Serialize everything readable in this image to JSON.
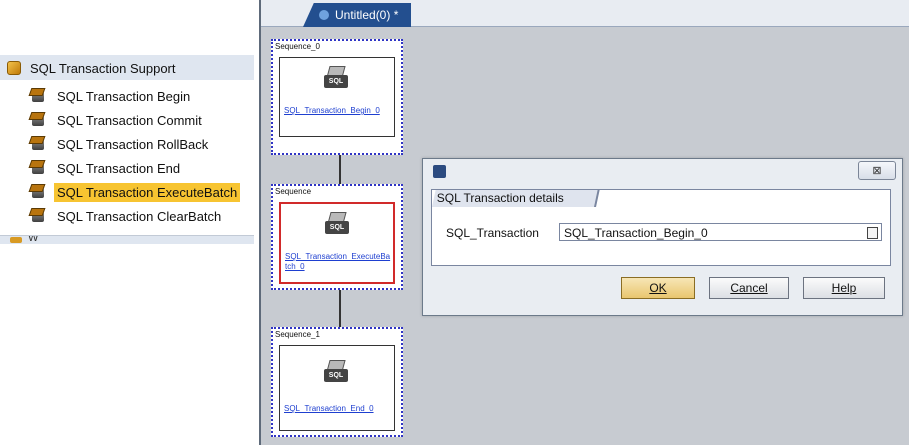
{
  "palette": {
    "header": "SQL Transaction Support",
    "items": [
      {
        "label": "SQL Transaction Begin",
        "selected": false
      },
      {
        "label": "SQL Transaction Commit",
        "selected": false
      },
      {
        "label": "SQL Transaction RollBack",
        "selected": false
      },
      {
        "label": "SQL Transaction End",
        "selected": false
      },
      {
        "label": "SQL Transaction ExecuteBatch",
        "selected": true
      },
      {
        "label": "SQL Transaction ClearBatch",
        "selected": false
      }
    ],
    "next_group_partial": "W"
  },
  "editor": {
    "tab_label": "Untitled(0) *",
    "sequences": [
      {
        "label": "Sequence_0",
        "icon_text": "SQL",
        "node_name": "SQL_Transaction_Begin_0"
      },
      {
        "label": "Sequence",
        "icon_text": "SQL",
        "node_name": "SQL_Transaction_ExecuteBatch_0"
      },
      {
        "label": "Sequence_1",
        "icon_text": "SQL",
        "node_name": "SQL_Transaction_End_0"
      }
    ]
  },
  "dialog": {
    "close_symbol": "⊠",
    "group_title": "SQL Transaction details",
    "field_label": "SQL_Transaction",
    "field_value": "SQL_Transaction_Begin_0",
    "buttons": {
      "ok": "OK",
      "cancel": "Cancel",
      "help": "Help"
    }
  },
  "colors": {
    "selected_highlight": "#f7c431",
    "tab_active": "#234f8f",
    "node_link": "#1e3fd0",
    "selected_node_border": "#d12a2a",
    "sequence_border": "#2f34c4"
  }
}
